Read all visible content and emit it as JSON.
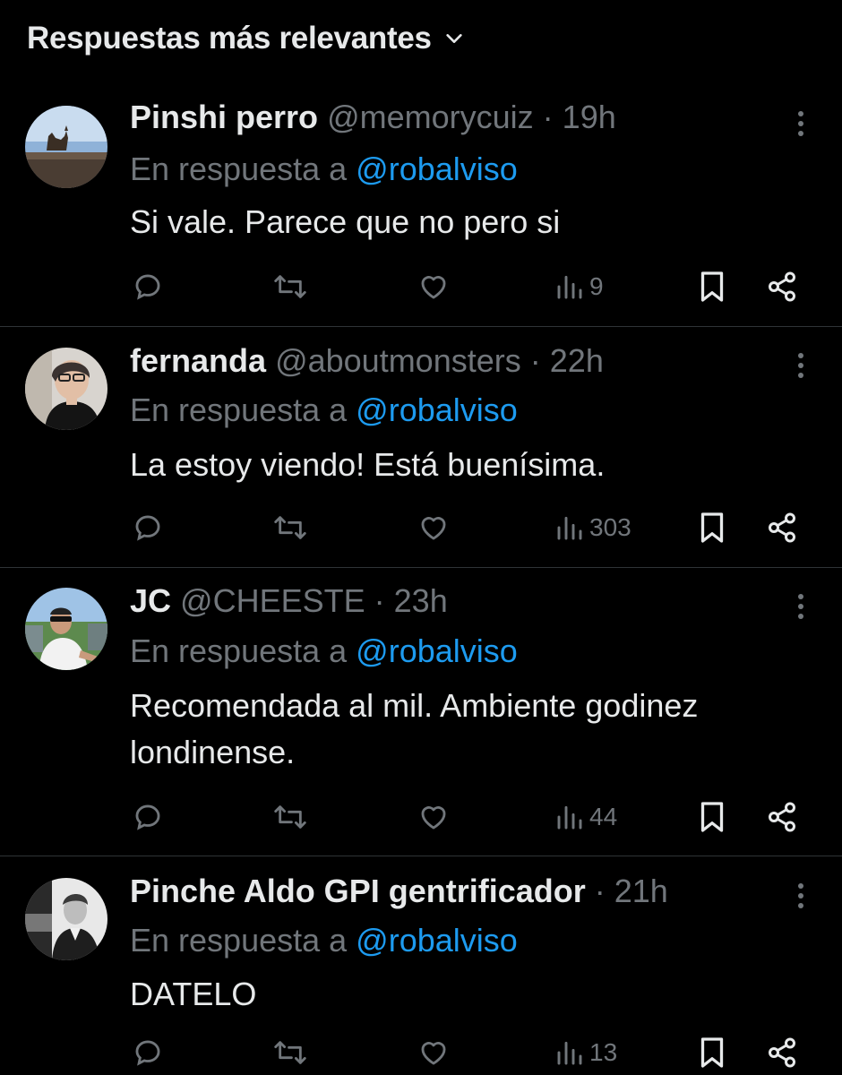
{
  "sort": {
    "label": "Respuestas más relevantes"
  },
  "replies": [
    {
      "name": "Pinshi perro",
      "handle": "@memorycuiz",
      "time": "19h",
      "reply_prefix": "En respuesta a",
      "reply_to": "@robalviso",
      "text_lines": [
        "Si vale. Parece que no pero si"
      ],
      "views": "9"
    },
    {
      "name": "fernanda",
      "handle": "@aboutmonsters",
      "time": "22h",
      "reply_prefix": "En respuesta a",
      "reply_to": "@robalviso",
      "text_lines": [
        "La estoy viendo! Está buenísima."
      ],
      "views": "303"
    },
    {
      "name": "JC",
      "handle": "@CHEESTE",
      "time": "23h",
      "reply_prefix": "En respuesta a",
      "reply_to": "@robalviso",
      "text_lines": [
        "Recomendada al mil. Ambiente godinez",
        "londinense."
      ],
      "views": "44"
    },
    {
      "name": "Pinche Aldo GPI gentrificador",
      "handle": "",
      "time": "21h",
      "reply_prefix": "En respuesta a",
      "reply_to": "@robalviso",
      "text_lines": [
        "DATELO"
      ],
      "views": "13"
    }
  ],
  "colors": {
    "background": "#000000",
    "text": "#e7e9ea",
    "muted": "#71767b",
    "link": "#1d9bf0",
    "divider": "#2f3336"
  },
  "icons": [
    "chevron-down-icon",
    "more-vertical-icon",
    "reply-icon",
    "retweet-icon",
    "like-icon",
    "views-icon",
    "bookmark-icon",
    "share-icon"
  ]
}
